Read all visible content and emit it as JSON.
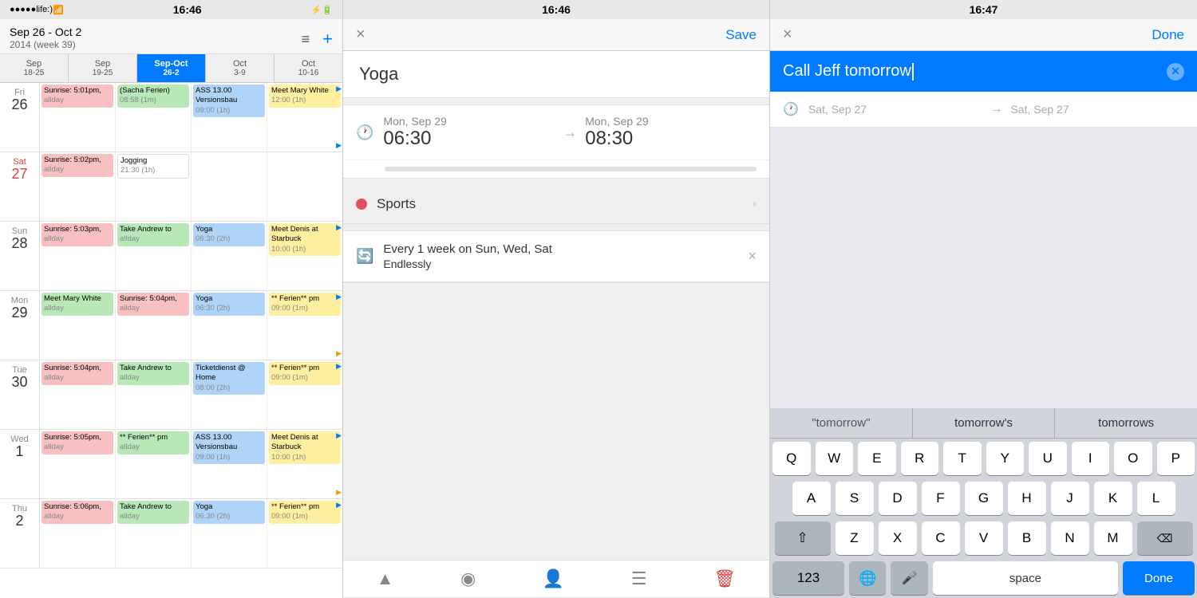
{
  "panel1": {
    "status": {
      "dots": "●●●●●",
      "carrier": "life:)",
      "wifi": "WiFi",
      "time": "16:46",
      "battery": "Battery"
    },
    "header": {
      "title": "Sep 26 - Oct 2",
      "subtitle": "2014 (week 39)",
      "menu_btn": "≡",
      "add_btn": "+"
    },
    "nav": [
      {
        "label": "Sep",
        "dates": "18-25"
      },
      {
        "label": "Sep",
        "dates": "19-25"
      },
      {
        "label": "Sep-Oct",
        "dates": "26-2",
        "active": true
      },
      {
        "label": "Oct",
        "dates": "3-9"
      },
      {
        "label": "Oct",
        "dates": "10-16"
      }
    ],
    "rows": [
      {
        "day_name": "Fri",
        "day_num": "26",
        "today": false,
        "cells": [
          [
            {
              "text": "Sunrise: 5:01pm,",
              "sub": "allday",
              "color": "pink"
            }
          ],
          [
            {
              "text": "(Sacha Ferien)",
              "sub": "08:58 (1m)",
              "color": "green"
            }
          ],
          [
            {
              "text": "ASS 13.00 Versionsbau",
              "sub": "09:00 (1h)",
              "color": "blue"
            }
          ],
          [
            {
              "text": "Meet Mary White",
              "sub": "12:00 (1h)",
              "color": "yellow",
              "arrow": true
            }
          ]
        ]
      },
      {
        "day_name": "Sat",
        "day_num": "27",
        "today": false,
        "cells": [
          [
            {
              "text": "Sunrise: 5:02pm,",
              "sub": "allday",
              "color": "pink"
            }
          ],
          [
            {
              "text": "Jogging",
              "sub": "21:30 (1h)",
              "color": "white"
            }
          ],
          [],
          []
        ]
      },
      {
        "day_name": "Sun",
        "day_num": "28",
        "today": false,
        "cells": [
          [
            {
              "text": "Sunrise: 5:03pm,",
              "sub": "allday",
              "color": "pink"
            }
          ],
          [
            {
              "text": "Take Andrew to",
              "sub": "allday",
              "color": "green"
            }
          ],
          [
            {
              "text": "Yoga",
              "sub": "06:30 (2h)",
              "color": "blue"
            }
          ],
          [
            {
              "text": "Meet Denis at Starbuck",
              "sub": "10:00 (1h)",
              "color": "yellow",
              "arrow": true
            }
          ]
        ]
      },
      {
        "day_name": "Mon",
        "day_num": "29",
        "today": false,
        "cells": [
          [
            {
              "text": "Meet Mary White",
              "sub": "allday",
              "color": "green"
            }
          ],
          [
            {
              "text": "Sunrise: 5:04pm,",
              "sub": "allday",
              "color": "pink"
            }
          ],
          [
            {
              "text": "Yoga",
              "sub": "06:30 (2h)",
              "color": "blue"
            }
          ],
          [
            {
              "text": "** Ferien** pm",
              "sub": "09:00 (1m)",
              "color": "yellow",
              "arrow": true
            }
          ]
        ]
      },
      {
        "day_name": "Tue",
        "day_num": "30",
        "today": false,
        "cells": [
          [
            {
              "text": "Sunrise: 5:04pm,",
              "sub": "allday",
              "color": "pink"
            }
          ],
          [
            {
              "text": "Take Andrew to",
              "sub": "allday",
              "color": "green"
            }
          ],
          [
            {
              "text": "Ticketdienst @ Home",
              "sub": "08:00 (2h)",
              "color": "blue"
            }
          ],
          [
            {
              "text": "** Ferien** pm",
              "sub": "09:00 (1m)",
              "color": "yellow",
              "arrow": true
            }
          ]
        ]
      },
      {
        "day_name": "Wed",
        "day_num": "1",
        "today": false,
        "cells": [
          [
            {
              "text": "Sunrise: 5:05pm,",
              "sub": "allday",
              "color": "pink"
            }
          ],
          [
            {
              "text": "** Ferien** pm",
              "sub": "allday",
              "color": "green"
            }
          ],
          [
            {
              "text": "ASS 13.00 Versionsbau",
              "sub": "09:00 (1h)",
              "color": "blue"
            }
          ],
          [
            {
              "text": "Meet Denis at Starbuck",
              "sub": "10:00 (1h)",
              "color": "yellow",
              "arrow": true
            }
          ]
        ]
      },
      {
        "day_name": "Thu",
        "day_num": "2",
        "today": false,
        "cells": [
          [
            {
              "text": "Sunrise: 5:06pm,",
              "sub": "allday",
              "color": "pink"
            }
          ],
          [
            {
              "text": "Take Andrew to",
              "sub": "allday",
              "color": "green"
            }
          ],
          [
            {
              "text": "Yoga",
              "sub": "06:30 (2h)",
              "color": "blue"
            }
          ],
          [
            {
              "text": "** Ferien** pm",
              "sub": "09:00 (1m)",
              "color": "yellow",
              "arrow": true
            }
          ]
        ]
      }
    ]
  },
  "panel2": {
    "status_time": "16:46",
    "nav": {
      "close": "×",
      "save": "Save"
    },
    "event": {
      "title": "Yoga",
      "start_date": "Mon, Sep 29",
      "start_time": "06:30",
      "end_date": "Mon, Sep 29",
      "end_time": "08:30",
      "calendar": "Sports",
      "dot_color": "#e05060",
      "repeat_text": "Every 1 week on Sun, Wed, Sat",
      "repeat_sub": "Endlessly"
    },
    "toolbar": {
      "alarm": "🔔",
      "location": "📍",
      "person": "👤",
      "note": "📋",
      "delete": "🗑"
    }
  },
  "panel3": {
    "status_time": "16:47",
    "nav": {
      "close": "×",
      "done": "Done"
    },
    "note_text": "Call Jeff tomorrow",
    "time": {
      "start_date": "Sat, Sep 27",
      "end_date": "Sat, Sep 27"
    },
    "autocorrect": [
      {
        "text": "\"tomorrow\"",
        "quoted": true
      },
      {
        "text": "tomorrow's",
        "quoted": false
      },
      {
        "text": "tomorrows",
        "quoted": false
      }
    ],
    "keyboard": {
      "rows": [
        [
          "Q",
          "W",
          "E",
          "R",
          "T",
          "Y",
          "U",
          "I",
          "O",
          "P"
        ],
        [
          "A",
          "S",
          "D",
          "F",
          "G",
          "H",
          "J",
          "K",
          "L"
        ],
        [
          "Z",
          "X",
          "C",
          "V",
          "B",
          "N",
          "M"
        ]
      ],
      "bottom": {
        "num_label": "123",
        "globe": "🌐",
        "mic": "🎤",
        "space": "space",
        "done": "Done"
      }
    }
  }
}
